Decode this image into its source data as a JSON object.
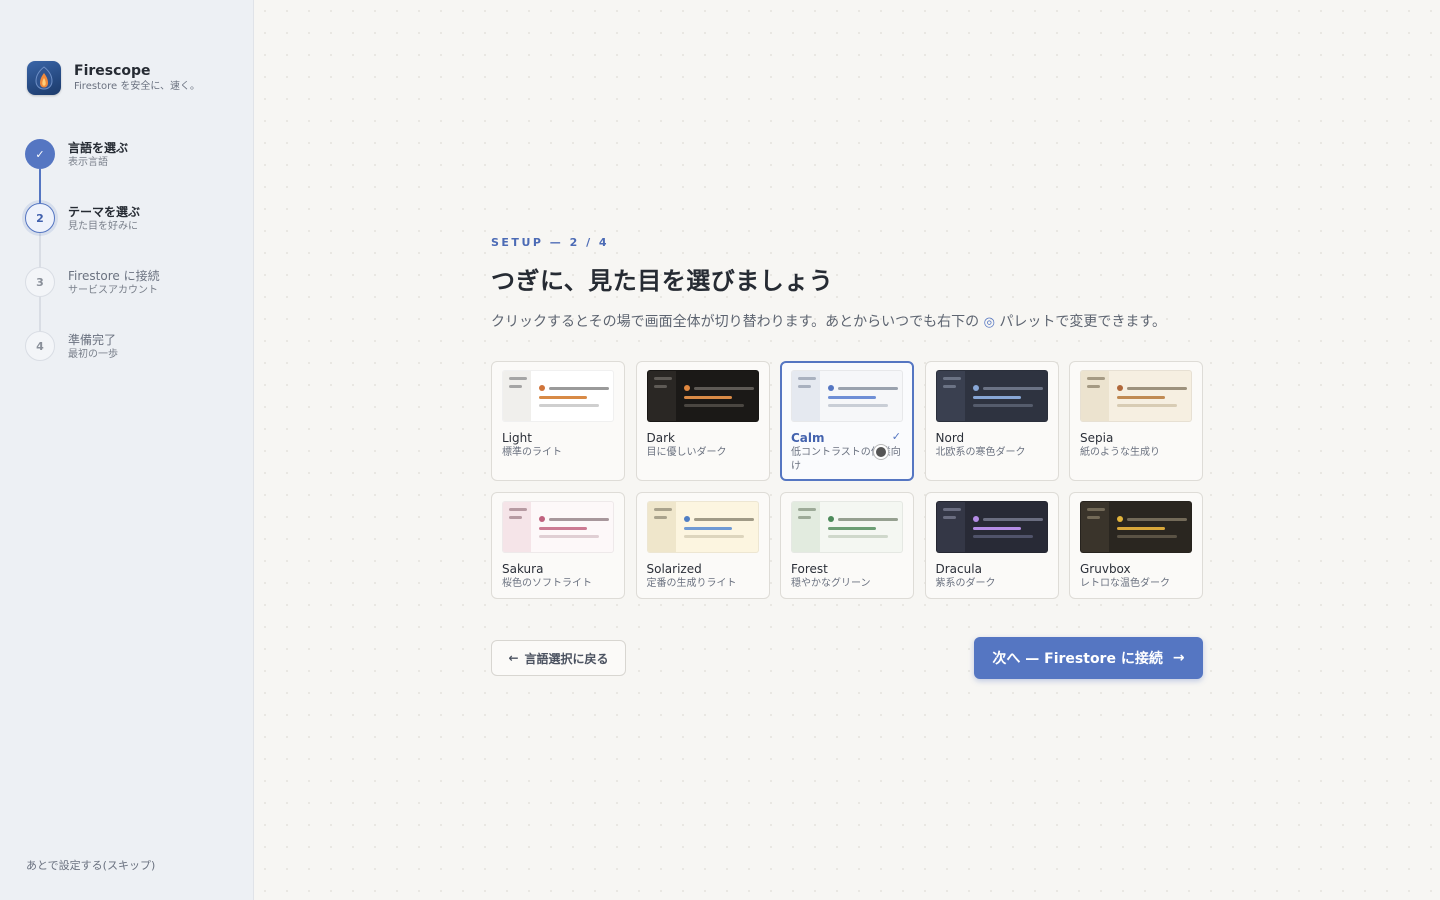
{
  "brand": {
    "name": "Firescope",
    "tagline": "Firestore を安全に、速く。"
  },
  "steps": [
    {
      "num": "✓",
      "title": "言語を選ぶ",
      "sub": "表示言語",
      "state": "done"
    },
    {
      "num": "2",
      "title": "テーマを選ぶ",
      "sub": "見た目を好みに",
      "state": "current"
    },
    {
      "num": "3",
      "title": "Firestore に接続",
      "sub": "サービスアカウント",
      "state": "todo"
    },
    {
      "num": "4",
      "title": "準備完了",
      "sub": "最初の一歩",
      "state": "todo"
    }
  ],
  "skip_label": "あとで設定する(スキップ)",
  "eyebrow": "SETUP — 2 / 4",
  "headline": "つぎに、見た目を選びましょう",
  "description_before": "クリックするとその場で画面全体が切り替わります。あとからいつでも右下の ",
  "palette_icon": "◎",
  "description_after": " パレットで変更できます。",
  "selected_check": "✓",
  "themes": [
    {
      "name": "Light",
      "desc": "標準のライト",
      "colors": {
        "bg": "#ffffff",
        "side": "#f0efec",
        "bar": "#a5a5a5",
        "dot": "#d0743a",
        "l1": "#9a9a9a",
        "l2": "#d88a46",
        "l3": "#cfcfcf"
      }
    },
    {
      "name": "Dark",
      "desc": "目に優しいダーク",
      "colors": {
        "bg": "#1b1917",
        "side": "#2a2724",
        "bar": "#5e5a55",
        "dot": "#e0873f",
        "l1": "#5e5a55",
        "l2": "#d88a46",
        "l3": "#4a4641"
      }
    },
    {
      "name": "Calm",
      "desc": "低コントラストの作業向け",
      "colors": {
        "bg": "#f6f7f9",
        "side": "#e5e9f0",
        "bar": "#a9b1bf",
        "dot": "#5576c2",
        "l1": "#9aa2ae",
        "l2": "#6f8fd6",
        "l3": "#c9ced6"
      }
    },
    {
      "name": "Nord",
      "desc": "北欧系の寒色ダーク",
      "colors": {
        "bg": "#2e3340",
        "side": "#3a4050",
        "bar": "#6b7385",
        "dot": "#88a7d6",
        "l1": "#6b7385",
        "l2": "#88a7d6",
        "l3": "#555c6c"
      }
    },
    {
      "name": "Sepia",
      "desc": "紙のような生成り",
      "colors": {
        "bg": "#f6efe1",
        "side": "#ece3cf",
        "bar": "#a59a84",
        "dot": "#b0683a",
        "l1": "#9d917c",
        "l2": "#c08a52",
        "l3": "#d8ccb4"
      }
    },
    {
      "name": "Sakura",
      "desc": "桜色のソフトライト",
      "colors": {
        "bg": "#fdf8f9",
        "side": "#f5e4e8",
        "bar": "#b69aa2",
        "dot": "#c0627f",
        "l1": "#a8979c",
        "l2": "#cc7a93",
        "l3": "#e0cfd4"
      }
    },
    {
      "name": "Solarized",
      "desc": "定番の生成りライト",
      "colors": {
        "bg": "#fcf5e0",
        "side": "#efe6cb",
        "bar": "#a9a28c",
        "dot": "#4f7ec4",
        "l1": "#a09a86",
        "l2": "#6f9ad4",
        "l3": "#ddd5bd"
      }
    },
    {
      "name": "Forest",
      "desc": "穏やかなグリーン",
      "colors": {
        "bg": "#f4f7f2",
        "side": "#e2ebdf",
        "bar": "#9daa98",
        "dot": "#4c8a5a",
        "l1": "#95a090",
        "l2": "#6c9e74",
        "l3": "#cfd8cb"
      }
    },
    {
      "name": "Dracula",
      "desc": "紫系のダーク",
      "colors": {
        "bg": "#282a36",
        "side": "#343746",
        "bar": "#6a6d80",
        "dot": "#b58de6",
        "l1": "#6a6d80",
        "l2": "#b58de6",
        "l3": "#50536a"
      }
    },
    {
      "name": "Gruvbox",
      "desc": "レトロな温色ダーク",
      "colors": {
        "bg": "#2a2620",
        "side": "#3a342b",
        "bar": "#736a58",
        "dot": "#e2b43b",
        "l1": "#736a58",
        "l2": "#d8a73a",
        "l3": "#5a5244"
      }
    }
  ],
  "selected_theme": "Calm",
  "back_arrow": "←",
  "back_label": "言語選択に戻る",
  "next_label": "次へ — Firestore に接続",
  "next_arrow": "→"
}
